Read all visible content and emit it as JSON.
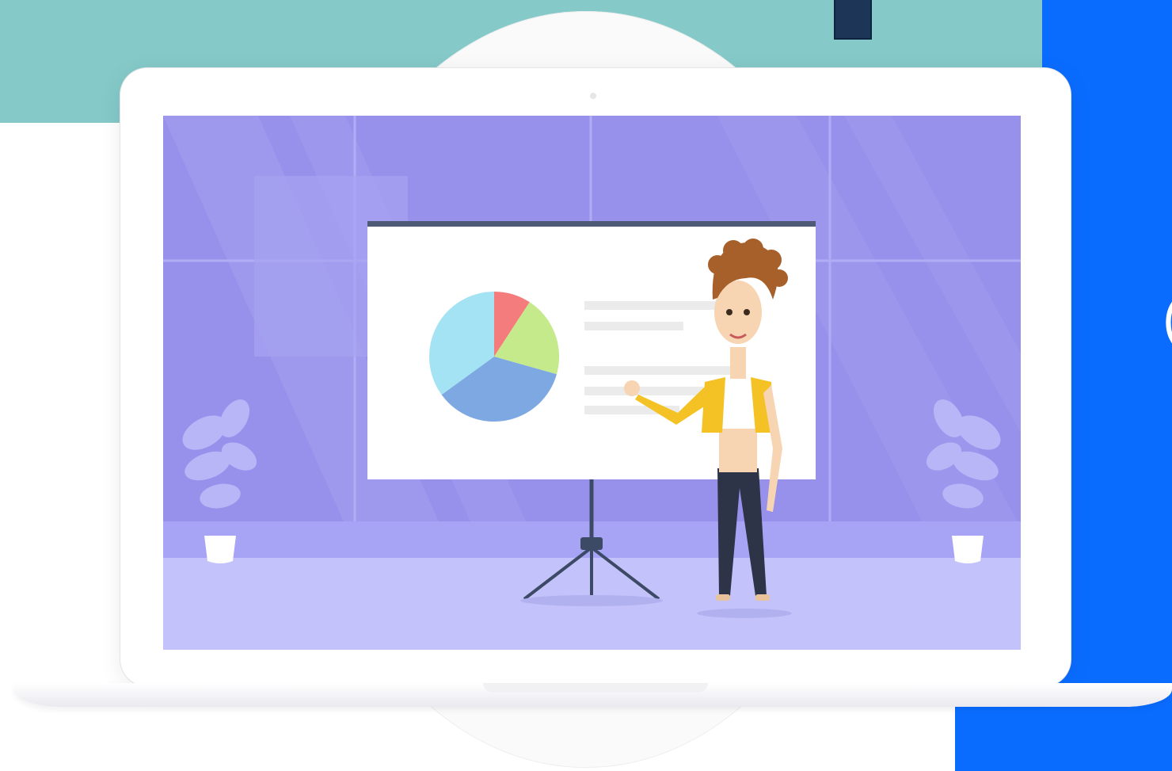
{
  "edge_glyph": "(",
  "colors": {
    "teal_band": "#85c9c9",
    "blue_panel": "#0a6cff",
    "screen_wall": "#9891ec",
    "screen_floor": "#c3c2fb",
    "pie_blue": "#7ea8e1",
    "pie_cyan": "#a4e3f3",
    "pie_red": "#f47c7c",
    "pie_green": "#c4ea8c",
    "jacket": "#f4c225"
  },
  "pie_slices": [
    {
      "name": "red",
      "percent": 8
    },
    {
      "name": "green",
      "percent": 15
    },
    {
      "name": "blue",
      "percent": 37
    },
    {
      "name": "cyan",
      "percent": 40
    }
  ],
  "icons": [
    "laptop-icon",
    "presentation-board-icon",
    "pie-chart-icon",
    "presenter-woman-icon",
    "potted-plant-icon",
    "tripod-icon"
  ]
}
